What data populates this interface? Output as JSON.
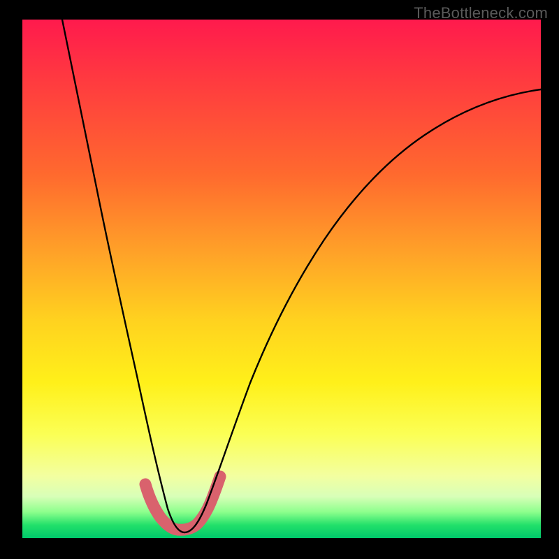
{
  "watermark": {
    "text": "TheBottleneck.com"
  },
  "chart_data": {
    "type": "line",
    "title": "",
    "xlabel": "",
    "ylabel": "",
    "xlim": [
      0,
      100
    ],
    "ylim": [
      0,
      100
    ],
    "grid": false,
    "legend": false,
    "series": [
      {
        "name": "bottleneck-curve",
        "comment": "V-shaped curve; y≈0 near x≈27–32, rising steeply on both sides (values estimated from pixel positions)",
        "x": [
          8,
          10,
          12,
          14,
          16,
          18,
          20,
          22,
          24,
          26,
          27,
          28,
          30,
          32,
          33,
          35,
          38,
          42,
          46,
          50,
          55,
          60,
          65,
          70,
          75,
          80,
          85,
          90,
          95,
          100
        ],
        "y": [
          100,
          90,
          79,
          67,
          55,
          44,
          34,
          25,
          16,
          8,
          5,
          3,
          2,
          3,
          5,
          8,
          14,
          22,
          30,
          37,
          45,
          52,
          58,
          63,
          67,
          71,
          74,
          76,
          78,
          79
        ]
      },
      {
        "name": "highlight-band",
        "comment": "short pink segment hugging the valley floor",
        "x": [
          24,
          25,
          26,
          27,
          28,
          29,
          30,
          31,
          32,
          33,
          34,
          35
        ],
        "y": [
          10,
          7,
          5,
          3.5,
          2.5,
          2,
          2,
          2.5,
          3.5,
          5,
          7,
          9
        ]
      }
    ],
    "colors": {
      "curve": "#000000",
      "highlight": "#d9626d",
      "gradient_top": "#ff1a4d",
      "gradient_mid": "#fff01a",
      "gradient_bottom": "#00c96b"
    }
  }
}
